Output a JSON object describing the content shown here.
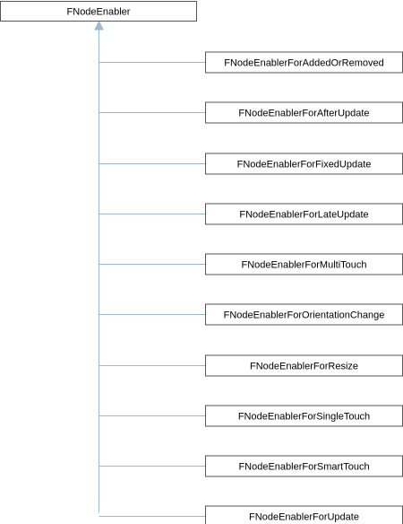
{
  "diagram": {
    "base_class": "FNodeEnabler",
    "derived_classes": [
      "FNodeEnablerForAddedOrRemoved",
      "FNodeEnablerForAfterUpdate",
      "FNodeEnablerForFixedUpdate",
      "FNodeEnablerForLateUpdate",
      "FNodeEnablerForMultiTouch",
      "FNodeEnablerForOrientationChange",
      "FNodeEnablerForResize",
      "FNodeEnablerForSingleTouch",
      "FNodeEnablerForSmartTouch",
      "FNodeEnablerForUpdate"
    ],
    "colors": {
      "edge": "#9ab9d5",
      "node_border": "#555555",
      "node_fill": "#ffffff"
    }
  }
}
